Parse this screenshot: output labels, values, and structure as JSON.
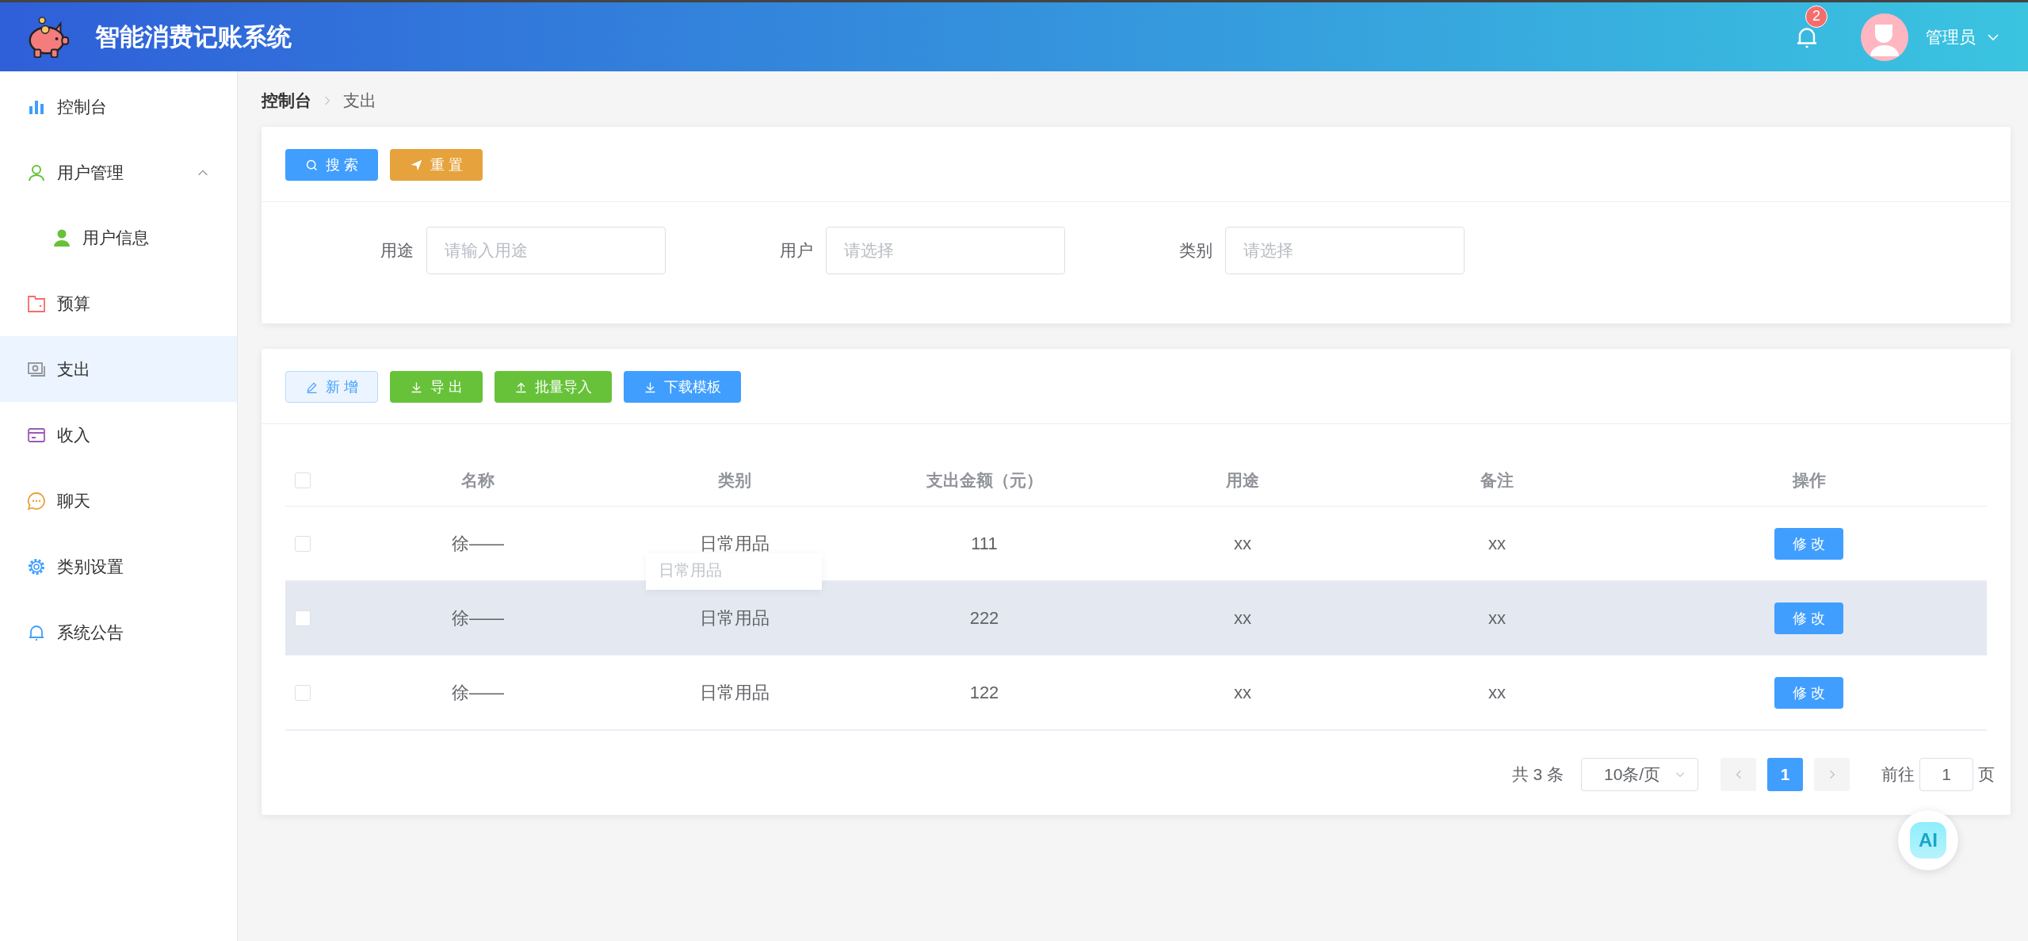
{
  "header": {
    "title": "智能消费记账系统",
    "notification_count": "2",
    "user": "管理员"
  },
  "sidebar": {
    "items": [
      {
        "label": "控制台",
        "selected": false
      },
      {
        "label": "用户管理",
        "selected": false,
        "expanded": true,
        "children": [
          {
            "label": "用户信息",
            "selected": false
          }
        ]
      },
      {
        "label": "预算",
        "selected": false
      },
      {
        "label": "支出",
        "selected": true
      },
      {
        "label": "收入",
        "selected": false
      },
      {
        "label": "聊天",
        "selected": false
      },
      {
        "label": "类别设置",
        "selected": false
      },
      {
        "label": "系统公告",
        "selected": false
      }
    ]
  },
  "breadcrumb": [
    "控制台",
    "支出"
  ],
  "search_panel": {
    "buttons": [
      {
        "label": "搜 索",
        "kind": "search"
      },
      {
        "label": "重 置",
        "kind": "reset"
      }
    ],
    "fields": [
      {
        "label": "用途",
        "placeholder": "请输入用途"
      },
      {
        "label": "用户",
        "placeholder": "请选择"
      },
      {
        "label": "类别",
        "placeholder": "请选择"
      }
    ]
  },
  "toolbar": [
    {
      "label": "新 增",
      "kind": "add"
    },
    {
      "label": "导 出",
      "kind": "export"
    },
    {
      "label": "批量导入",
      "kind": "import"
    },
    {
      "label": "下载模板",
      "kind": "template"
    }
  ],
  "table": {
    "all_checked": false,
    "columns": [
      "名称",
      "类别",
      "支出金额（元）",
      "用途",
      "备注",
      "操作"
    ],
    "rows": [
      {
        "checked": false,
        "highlighted": false,
        "cells": [
          "徐——",
          "日常用品",
          "111",
          "xx",
          "xx"
        ],
        "action": "修 改"
      },
      {
        "checked": false,
        "highlighted": true,
        "cells": [
          "徐——",
          "日常用品",
          "222",
          "xx",
          "xx"
        ],
        "action": "修 改"
      },
      {
        "checked": false,
        "highlighted": false,
        "cells": [
          "徐——",
          "日常用品",
          "122",
          "xx",
          "xx"
        ],
        "action": "修 改"
      }
    ],
    "tooltip": {
      "text": "日常用品"
    }
  },
  "pagination": {
    "total": "共 3 条",
    "page_size": "10条/页",
    "pages": [
      {
        "label": "1",
        "selected": true
      }
    ],
    "goto_label": "前往",
    "goto_value": "1",
    "goto_suffix": "页"
  },
  "ai_button": {
    "label": "AI"
  }
}
